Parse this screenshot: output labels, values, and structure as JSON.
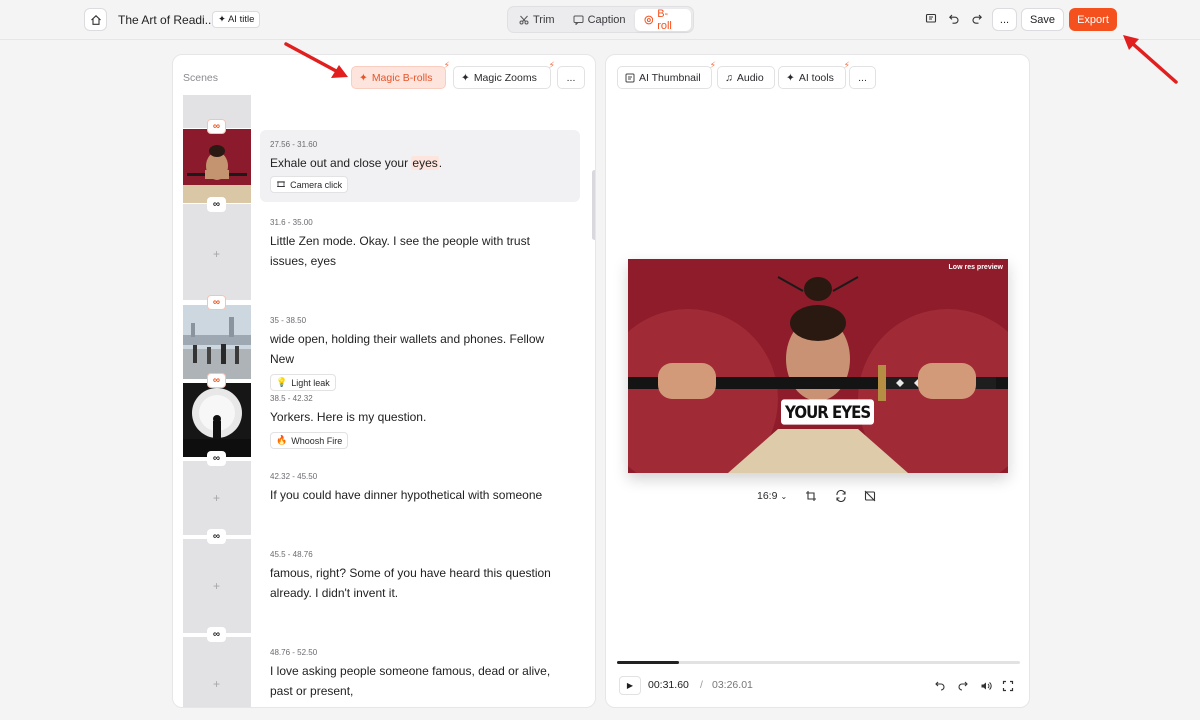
{
  "header": {
    "project_title": "The Art of Readi...",
    "ai_title_label": "AI title",
    "modes": [
      {
        "label": "Trim",
        "icon": "scissors-icon"
      },
      {
        "label": "Caption",
        "icon": "caption-icon"
      },
      {
        "label": "B-roll",
        "icon": "broll-icon",
        "active": true
      }
    ],
    "more_label": "...",
    "save_label": "Save",
    "export_label": "Export",
    "accent_color": "#f4511e"
  },
  "scenes_panel": {
    "label": "Scenes",
    "magic_brolls_label": "Magic B-rolls",
    "magic_zooms_label": "Magic Zooms",
    "more_label": "...",
    "scenes": [
      {
        "time": "27.56 - 31.60",
        "text_before": "Exhale out and close your ",
        "highlight": "eyes",
        "text_after": ".",
        "effect": "Camera click",
        "effect_icon": "film-icon"
      },
      {
        "time": "31.6 - 35.00",
        "text": "Little Zen mode. Okay. I see the people with trust issues, eyes"
      },
      {
        "time": "35 - 38.50",
        "text": "wide open, holding their wallets and phones. Fellow New",
        "effect": "Light leak",
        "effect_icon": "bulb-icon"
      },
      {
        "time": "38.5 - 42.32",
        "text": "Yorkers. Here is my question.",
        "effect": "Whoosh Fire",
        "effect_icon": "fire-icon"
      },
      {
        "time": "42.32 - 45.50",
        "text": "If you could have dinner hypothetical with someone"
      },
      {
        "time": "45.5 - 48.76",
        "text": "famous, right? Some of you have heard this question already. I didn't invent it."
      },
      {
        "time": "48.76 - 52.50",
        "text": "I love asking people someone famous, dead or alive, past or present,"
      }
    ]
  },
  "preview_panel": {
    "ai_thumbnail_label": "AI Thumbnail",
    "audio_label": "Audio",
    "ai_tools_label": "AI tools",
    "more_label": "...",
    "low_res_label": "Low res preview",
    "caption_text": "YOUR EYES",
    "aspect_ratio": "16:9",
    "current_time": "00:31.60",
    "time_separator": "/",
    "duration": "03:26.01",
    "progress_fraction": 0.153
  }
}
